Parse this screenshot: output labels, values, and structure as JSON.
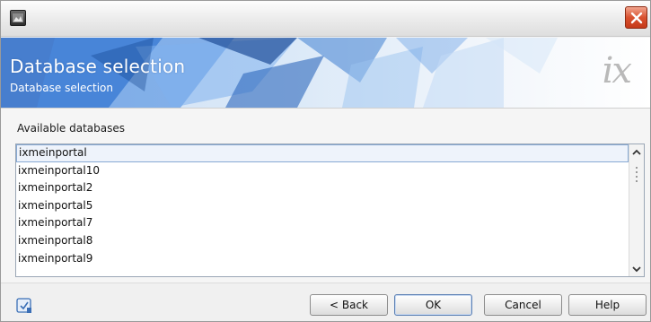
{
  "banner": {
    "title": "Database selection",
    "subtitle": "Database selection",
    "logo_text": "ix"
  },
  "section": {
    "label": "Available databases"
  },
  "databases": [
    "ixmeinportal",
    "ixmeinportal10",
    "ixmeinportal2",
    "ixmeinportal5",
    "ixmeinportal7",
    "ixmeinportal8",
    "ixmeinportal9"
  ],
  "selected_index": 0,
  "buttons": {
    "back": "< Back",
    "ok": "OK",
    "cancel": "Cancel",
    "help": "Help"
  },
  "icons": {
    "app": "app-icon",
    "close": "close-icon",
    "help": "help-icon",
    "scroll_up": "scroll-up-arrow-icon",
    "scroll_down": "scroll-down-arrow-icon"
  },
  "colors": {
    "close_button": "#d9512f",
    "banner_accent": "#3f7fd1",
    "logo": "#b9b9b9"
  }
}
